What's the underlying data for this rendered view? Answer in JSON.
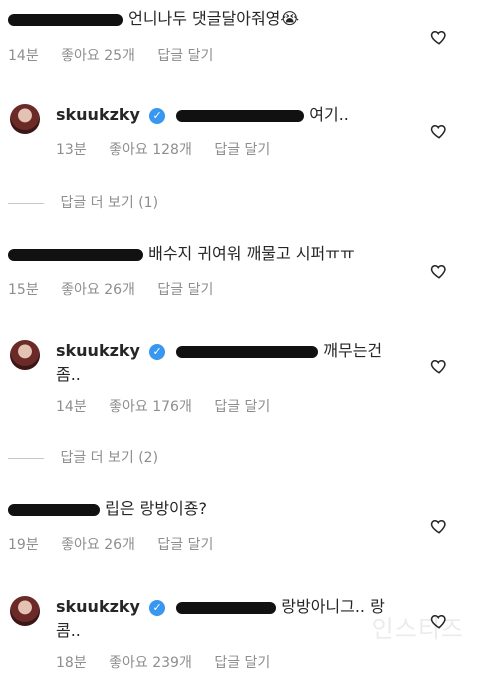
{
  "comments": [
    {
      "text": "언니나두 댓글달아줘영😭",
      "time": "14분",
      "likes": "좋아요 25개",
      "reply": "답글 달기"
    },
    {
      "username": "skuukzky",
      "text": "여기..",
      "time": "13분",
      "likes": "좋아요 128개",
      "reply": "답글 달기"
    },
    {
      "text": "배수지 귀여워 깨물고 시퍼ㅠㅠ",
      "time": "15분",
      "likes": "좋아요 26개",
      "reply": "답글 달기"
    },
    {
      "username": "skuukzky",
      "text": "깨무는건",
      "text2": "좀..",
      "time": "14분",
      "likes": "좋아요 176개",
      "reply": "답글 달기"
    },
    {
      "text": "립은 랑방이죵?",
      "time": "19분",
      "likes": "좋아요 26개",
      "reply": "답글 달기"
    },
    {
      "username": "skuukzky",
      "text": "랑방아니그.. 랑",
      "text2": "콤..",
      "time": "18분",
      "likes": "좋아요 239개",
      "reply": "답글 달기"
    }
  ],
  "view_more": [
    {
      "label": "답글 더 보기 (1)"
    },
    {
      "label": "답글 더 보기 (2)"
    }
  ],
  "watermark": "인스티즈",
  "icons": {
    "like": "heart-outline-icon",
    "verified": "verified-badge-icon"
  }
}
